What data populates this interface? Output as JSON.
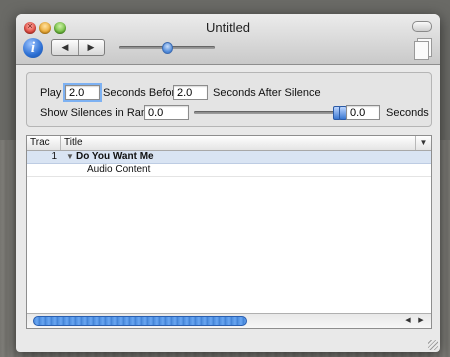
{
  "window": {
    "title": "Untitled",
    "close_glyph": "×"
  },
  "toolbar": {
    "info_label": "i",
    "back_glyph": "◀",
    "forward_glyph": "▶",
    "zoom_level": 0.5
  },
  "settings": {
    "play_label": "Play",
    "before_value": "2.0",
    "before_label": "Seconds Before,",
    "after_value": "2.0",
    "after_label": "Seconds After Silence",
    "range_label": "Show Silences in Range:",
    "range_min_value": "0.0",
    "range_max_value": "0.0",
    "range_unit_label": "Seconds"
  },
  "table": {
    "columns": [
      "Trac",
      "Title"
    ],
    "menu_glyph": "▼",
    "rows": [
      {
        "number": "1",
        "title": "Do You Want Me",
        "disclosure": "▼"
      }
    ],
    "sub_row": "Audio Content"
  },
  "scroll": {
    "left_glyph": "◀",
    "right_glyph": "▶"
  },
  "colors": {
    "accent": "#3b78d6",
    "selection": "#d9e4f3"
  }
}
